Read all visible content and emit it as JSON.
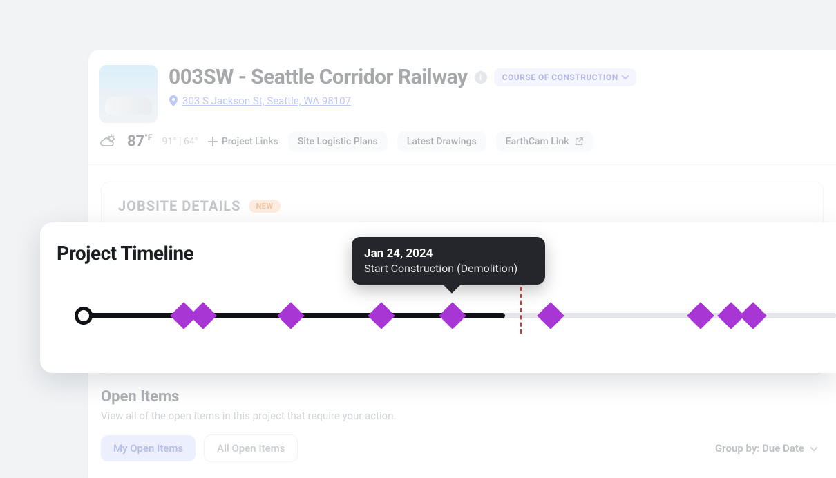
{
  "header": {
    "title": "003SW - Seattle Corridor Railway",
    "status": "COURSE OF CONSTRUCTION",
    "address": "303 S Jackson St, Seattle, WA 98107"
  },
  "weather": {
    "temp": "87",
    "unit": "°F",
    "high": "91°",
    "low": "64°"
  },
  "links": {
    "project_links": "Project Links",
    "site_logistic": "Site Logistic Plans",
    "latest_drawings": "Latest Drawings",
    "earthcam": "EarthCam Link"
  },
  "jobsite": {
    "title": "JOBSITE DETAILS",
    "badge": "NEW"
  },
  "timeline": {
    "title": "Project Timeline",
    "progress_pct": 56,
    "today_pct": 58,
    "milestones_pct": [
      13.2,
      15.8,
      27.5,
      39.5,
      49,
      62,
      82,
      86,
      89
    ],
    "tooltip": {
      "on_idx": 4,
      "date": "Jan 24, 2024",
      "desc": "Start Construction (Demolition)"
    }
  },
  "open_items": {
    "title": "Open Items",
    "subtitle": "View all of the open items in this project that require your action.",
    "my_btn": "My Open Items",
    "all_btn": "All Open Items",
    "groupby_label": "Group by: Due Date"
  }
}
